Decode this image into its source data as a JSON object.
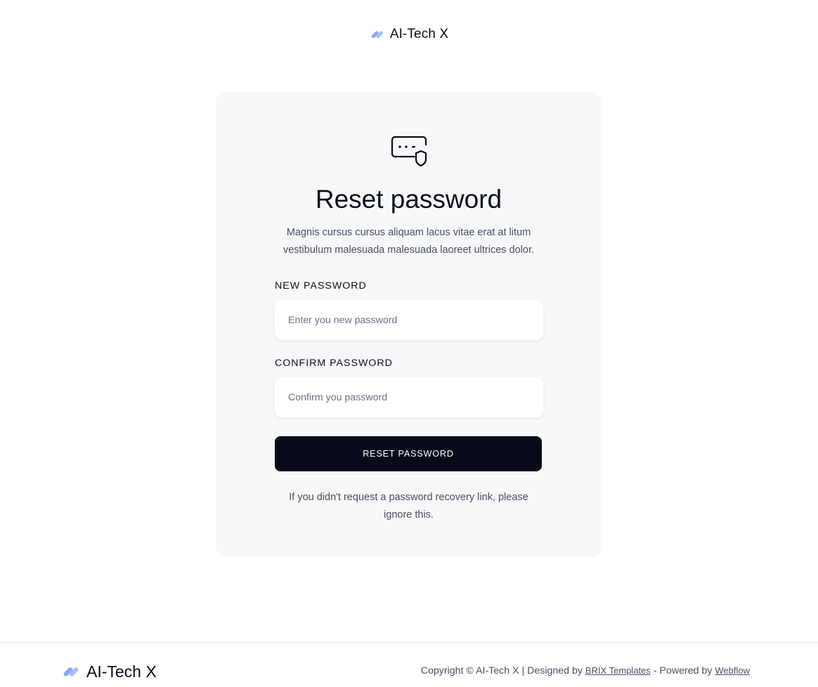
{
  "brand": {
    "name": "AI-Tech X",
    "logo_icon": "brand-slash-icon",
    "logo_color": "#8aa8f5"
  },
  "card": {
    "icon": "password-shield-icon",
    "title": "Reset password",
    "description": "Magnis cursus cursus aliquam lacus vitae erat at litum vestibulum malesuada malesuada laoreet ultrices dolor.",
    "new_password": {
      "label": "NEW PASSWORD",
      "placeholder": "Enter you new password",
      "value": ""
    },
    "confirm_password": {
      "label": "CONFIRM PASSWORD",
      "placeholder": "Confirm you password",
      "value": ""
    },
    "submit_label": "RESET PASSWORD",
    "note": "If you didn't request a password recovery link, please ignore this."
  },
  "footer": {
    "copyright_prefix": "Copyright © AI-Tech X | Designed by ",
    "designer_link": "BRIX Templates",
    "powered_prefix": " - Powered by ",
    "platform_link": "Webflow"
  },
  "colors": {
    "accent": "#8aa8f5",
    "button_bg": "#080a19",
    "card_bg": "#f7f8fa",
    "text": "#0b0d1c",
    "muted_text": "#4b4f63"
  }
}
